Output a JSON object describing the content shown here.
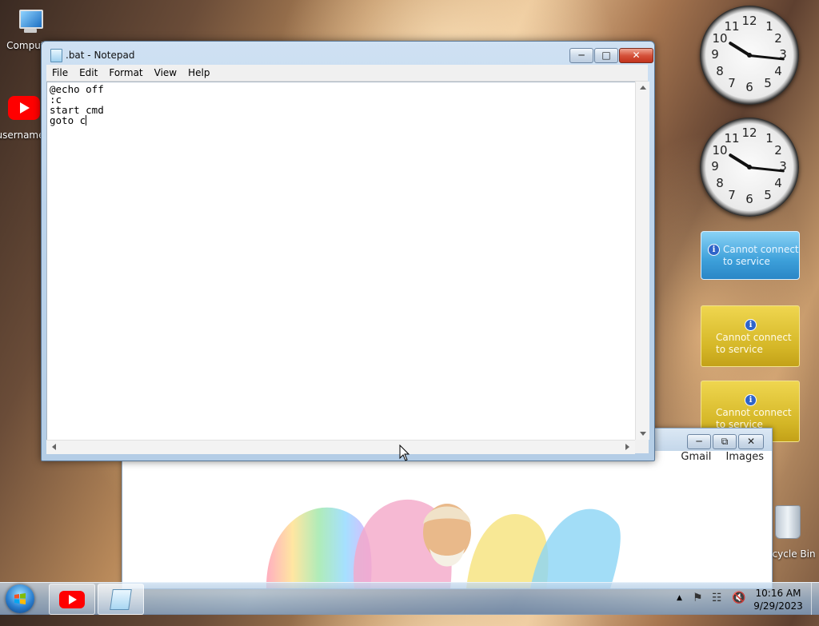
{
  "desktop": {
    "icons": [
      {
        "label": "Computer"
      },
      {
        "label": "username"
      },
      {
        "label": "Recycle Bin"
      }
    ]
  },
  "gadgets": {
    "clocks": [
      {
        "numbers": [
          "12",
          "1",
          "2",
          "3",
          "4",
          "5",
          "6",
          "7",
          "8",
          "9",
          "10",
          "11"
        ]
      },
      {
        "numbers": [
          "12",
          "1",
          "2",
          "3",
          "4",
          "5",
          "6",
          "7",
          "8",
          "9",
          "10",
          "11"
        ]
      }
    ],
    "cards": [
      {
        "line1": "Cannot connect",
        "line2": "to service"
      },
      {
        "line1": "Cannot connect",
        "line2": "to service"
      },
      {
        "line1": "Cannot connect",
        "line2": "to service"
      }
    ]
  },
  "browser": {
    "links": [
      "Gmail",
      "Images"
    ]
  },
  "notepad": {
    "title": ".bat - Notepad",
    "menu": [
      "File",
      "Edit",
      "Format",
      "View",
      "Help"
    ],
    "lines": [
      "@echo off",
      ":c",
      "start cmd",
      "goto c"
    ]
  },
  "taskbar": {
    "time": "10:16 AM",
    "date": "9/29/2023"
  }
}
